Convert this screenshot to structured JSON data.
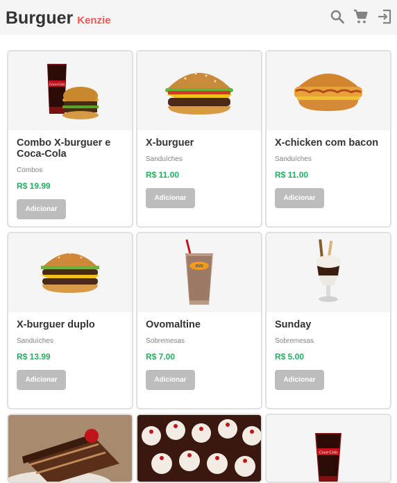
{
  "header": {
    "brand_main": "Burguer",
    "brand_sub": "Kenzie",
    "icons": [
      "search-icon",
      "cart-icon",
      "logout-icon"
    ]
  },
  "products": [
    {
      "name": "Combo X-burguer e Coca-Cola",
      "category": "Combos",
      "price": "R$ 19.99",
      "button": "Adicionar",
      "image": "combo-image"
    },
    {
      "name": "X-burguer",
      "category": "Sanduíches",
      "price": "R$ 11.00",
      "button": "Adicionar",
      "image": "burger-image"
    },
    {
      "name": "X-chicken com bacon",
      "category": "Sanduíches",
      "price": "R$ 11.00",
      "button": "Adicionar",
      "image": "chicken-burger-image"
    },
    {
      "name": "X-burguer duplo",
      "category": "Sanduíches",
      "price": "R$ 13.99",
      "button": "Adicionar",
      "image": "double-burger-image"
    },
    {
      "name": "Ovomaltine",
      "category": "Sobremesas",
      "price": "R$ 7.00",
      "button": "Adicionar",
      "image": "milkshake-image"
    },
    {
      "name": "Sunday",
      "category": "Sobremesas",
      "price": "R$ 5.00",
      "button": "Adicionar",
      "image": "sundae-image"
    },
    {
      "image": "cake-image"
    },
    {
      "image": "cupcakes-image"
    },
    {
      "image": "cola-image"
    }
  ],
  "colors": {
    "header_bg": "#f5f5f5",
    "brand_accent": "#eb5757",
    "price": "#27ae60",
    "button_bg": "#bdbdbd",
    "card_border": "#e0e0e0"
  }
}
